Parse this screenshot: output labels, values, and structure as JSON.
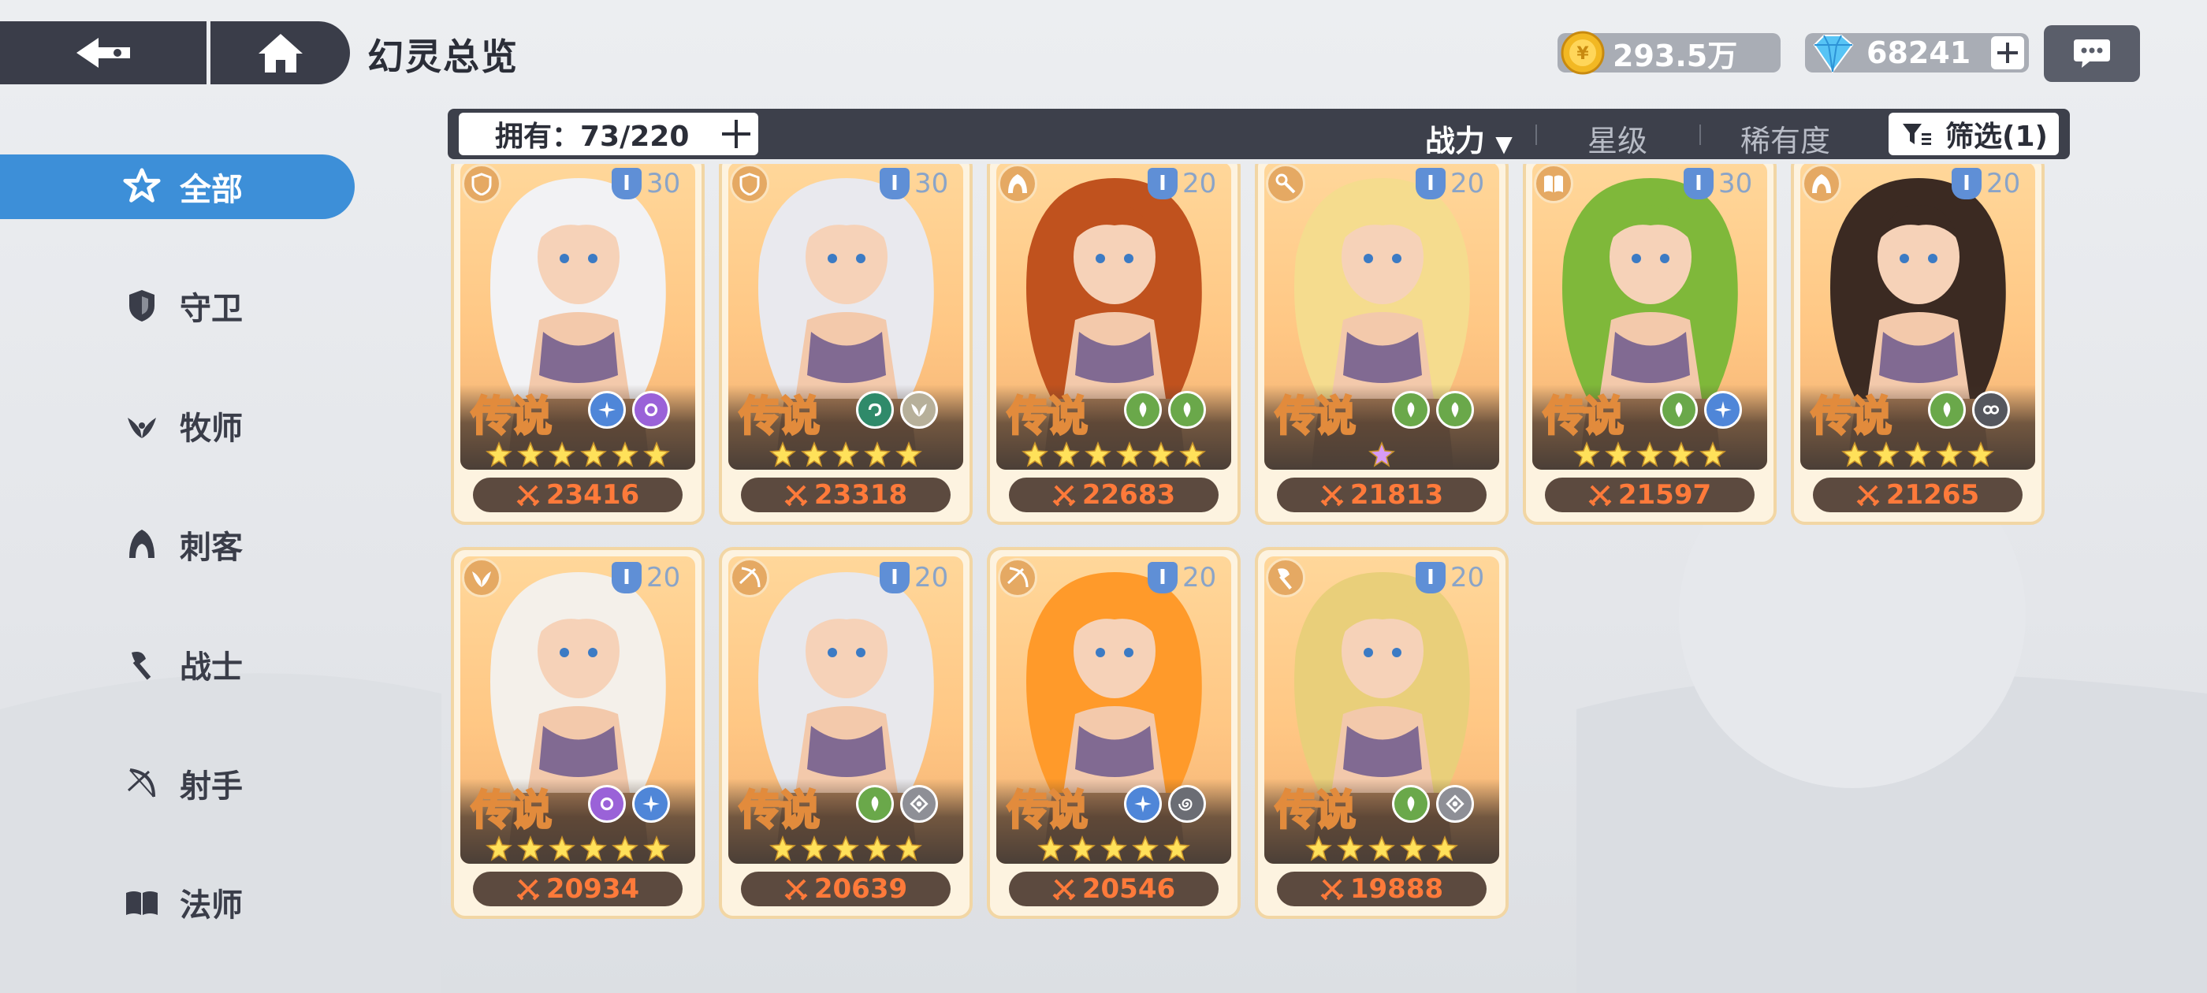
{
  "header": {
    "title": "幻灵总览",
    "coins": "293.5万",
    "gems": "68241"
  },
  "sidebar": {
    "items": [
      {
        "label": "全部",
        "icon": "all-classes-icon",
        "active": true
      },
      {
        "label": "守卫",
        "icon": "shield-icon",
        "active": false
      },
      {
        "label": "牧师",
        "icon": "wings-icon",
        "active": false
      },
      {
        "label": "刺客",
        "icon": "hood-icon",
        "active": false
      },
      {
        "label": "战士",
        "icon": "axe-icon",
        "active": false
      },
      {
        "label": "射手",
        "icon": "bow-icon",
        "active": false
      },
      {
        "label": "法师",
        "icon": "book-icon",
        "active": false
      }
    ]
  },
  "toolbar": {
    "own_label": "拥有：73/220",
    "sort_power": "战力",
    "sort_power_arrow": "▼",
    "sort_star": "星级",
    "sort_rarity": "稀有度",
    "filter_label": "筛选(1)"
  },
  "colors": {
    "accent": "#3d8fd8",
    "bar": "#3d404b",
    "power": "#ff7a3a",
    "star": "#ffe15a",
    "purple_star": "#d79cf5"
  },
  "cards": [
    {
      "rarity": "传说",
      "level": "30",
      "level_badge": "I",
      "class_icon": "shield-icon",
      "elements": [
        "ice",
        "purple"
      ],
      "stars": 6,
      "star_color": "gold",
      "power": "23416",
      "hair": "#f2f2f4"
    },
    {
      "rarity": "传说",
      "level": "30",
      "level_badge": "I",
      "class_icon": "shield-icon",
      "elements": [
        "green-dark",
        "wings"
      ],
      "stars": 5,
      "star_color": "gold",
      "power": "23318",
      "hair": "#e9e9ee"
    },
    {
      "rarity": "传说",
      "level": "20",
      "level_badge": "I",
      "class_icon": "hood-icon",
      "elements": [
        "leaf",
        "leaf"
      ],
      "stars": 6,
      "star_color": "gold",
      "power": "22683",
      "hair": "#c0521e"
    },
    {
      "rarity": "传说",
      "level": "20",
      "level_badge": "I",
      "class_icon": "staff-icon",
      "elements": [
        "leaf",
        "leaf"
      ],
      "stars": 1,
      "star_color": "purple",
      "power": "21813",
      "hair": "#f5dc8e"
    },
    {
      "rarity": "传说",
      "level": "30",
      "level_badge": "I",
      "class_icon": "book-icon",
      "elements": [
        "leaf",
        "ice"
      ],
      "stars": 5,
      "star_color": "gold",
      "power": "21597",
      "hair": "#7fb83a"
    },
    {
      "rarity": "传说",
      "level": "20",
      "level_badge": "I",
      "class_icon": "hood-icon",
      "elements": [
        "leaf",
        "dark"
      ],
      "stars": 5,
      "star_color": "gold",
      "power": "21265",
      "hair": "#3b2a22"
    },
    {
      "rarity": "传说",
      "level": "20",
      "level_badge": "I",
      "class_icon": "wings-icon",
      "elements": [
        "purple",
        "ice"
      ],
      "stars": 6,
      "star_color": "gold",
      "power": "20934",
      "hair": "#f4f0ea"
    },
    {
      "rarity": "传说",
      "level": "20",
      "level_badge": "I",
      "class_icon": "bow-icon",
      "elements": [
        "leaf",
        "grey"
      ],
      "stars": 5,
      "star_color": "gold",
      "power": "20639",
      "hair": "#e8e8ec"
    },
    {
      "rarity": "传说",
      "level": "20",
      "level_badge": "I",
      "class_icon": "bow-icon",
      "elements": [
        "ice",
        "swirl"
      ],
      "stars": 5,
      "star_color": "gold",
      "power": "20546",
      "hair": "#ff9a2a"
    },
    {
      "rarity": "传说",
      "level": "20",
      "level_badge": "I",
      "class_icon": "axe-icon",
      "elements": [
        "leaf",
        "grey"
      ],
      "stars": 5,
      "star_color": "gold",
      "power": "19888",
      "hair": "#e9cf7a"
    }
  ]
}
